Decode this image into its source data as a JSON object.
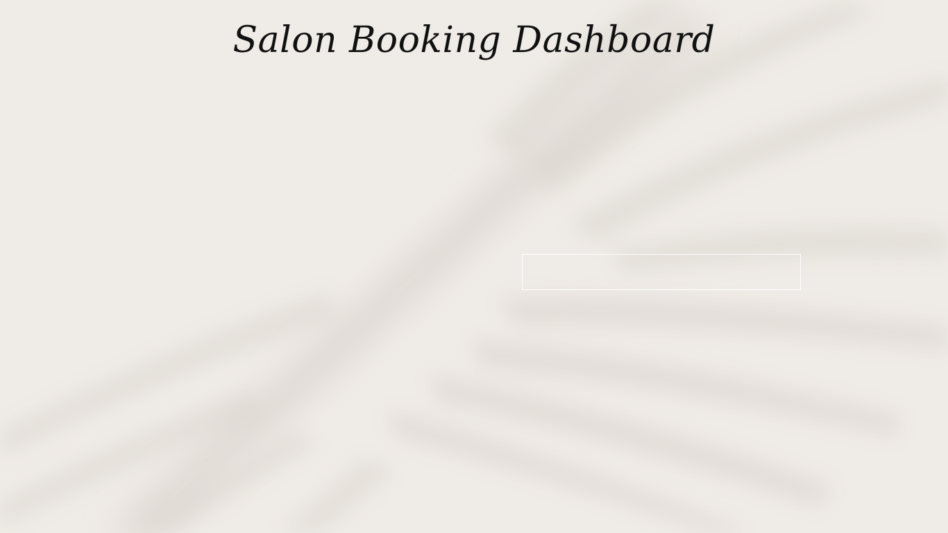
{
  "header": {
    "title": "Salon Booking Dashboard"
  },
  "form": {
    "input_value": "",
    "input_placeholder": ""
  },
  "colors": {
    "background": "#efebe6",
    "leaf_shadow": "#d6d1cb",
    "title_text": "#111111",
    "input_border": "#ffffff"
  },
  "background_image": "palm-leaf-shadow"
}
